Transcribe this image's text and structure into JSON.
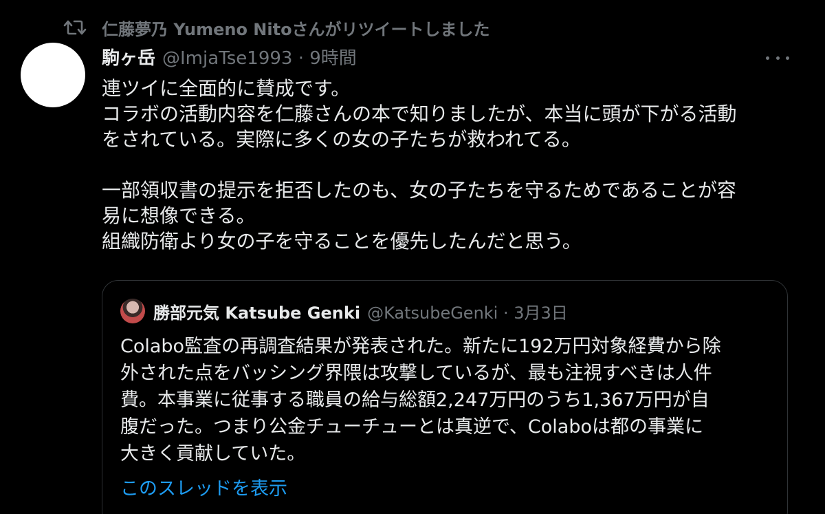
{
  "retweet": {
    "icon": "retweet-icon",
    "text": "仁藤夢乃  Yumeno Nitoさんがリツイートしました"
  },
  "tweet": {
    "display_name": "駒ヶ岳",
    "meta": "@ImjaTse1993 · 9時間",
    "more_icon": "more-icon",
    "lines": [
      "連ツイに全面的に賛成です。",
      "コラボの活動内容を仁藤さんの本で知りましたが、本当に頭が下がる活動",
      "をされている。実際に多くの女の子たちが救われてる。",
      "",
      "一部領収書の提示を拒否したのも、女の子たちを守るためであることが容",
      "易に想像できる。",
      "組織防衛より女の子を守ることを優先したんだと思う。"
    ]
  },
  "quote": {
    "display_name": "勝部元気 Katsube Genki",
    "meta": "@KatsubeGenki · 3月3日",
    "lines": [
      "Colabo監査の再調査結果が発表された。新たに192万円対象経費から除",
      "外された点をバッシング界隈は攻撃しているが、最も注視すべきは人件",
      "費。本事業に従事する職員の給与総額2,247万円のうち1,367万円が自",
      "腹だった。つまり公金チューチューとは真逆で、Colaboは都の事業に",
      "大きく貢献していた。"
    ],
    "thread_link": "このスレッドを表示"
  },
  "colors": {
    "background": "#000000",
    "text": "#e7e9ea",
    "muted": "#71767b",
    "link": "#1d9bf0",
    "border": "#2f3336"
  }
}
